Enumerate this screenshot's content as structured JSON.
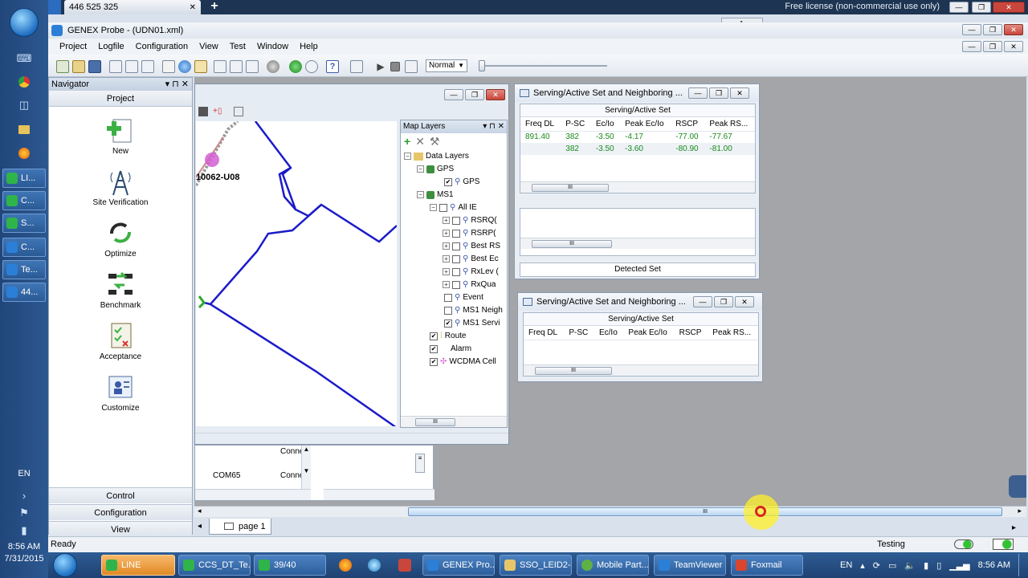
{
  "remote_tab": {
    "label": "446 525 325",
    "close": "✕"
  },
  "free_license": "Free license (non-commercial use only)",
  "window": {
    "title": "GENEX Probe - (UDN01.xml)"
  },
  "menu": [
    "Project",
    "Logfile",
    "Configuration",
    "View",
    "Test",
    "Window",
    "Help"
  ],
  "toolbar": {
    "zoom_mode": "Normal"
  },
  "navigator": {
    "title": "Navigator",
    "project_header": "Project",
    "items": [
      "New",
      "Site Verification",
      "Optimize",
      "Benchmark",
      "Acceptance",
      "Customize"
    ],
    "sections": [
      "Control",
      "Configuration",
      "View"
    ]
  },
  "map": {
    "site_label": "10062-U08",
    "layers_title": "Map Layers",
    "tree": {
      "data_layers": "Data Layers",
      "gps": "GPS",
      "gps_child": "GPS",
      "ms1": "MS1",
      "all_ie": "All IE",
      "children": [
        "RSRQ(",
        "RSRP(",
        "Best RS",
        "Best Ec",
        "RxLev (",
        "RxQua"
      ],
      "event": "Event",
      "ms1_neigh": "MS1 Neigh",
      "ms1_servi": "MS1 Servi",
      "route": "Route",
      "alarm": "Alarm",
      "wcdma_cell": "WCDMA Cell"
    }
  },
  "bottom_list": {
    "row1_status": "Conne",
    "row2_port": "COM65",
    "row2_status": "Conne"
  },
  "serving1": {
    "title": "Serving/Active Set and Neighboring ...",
    "section": "Serving/Active Set",
    "columns": [
      "Freq DL",
      "P-SC",
      "Ec/Io",
      "Peak Ec/Io",
      "RSCP",
      "Peak RS..."
    ],
    "rows": [
      [
        "891.40",
        "382",
        "-3.50",
        "-4.17",
        "-77.00",
        "-77.67"
      ],
      [
        "",
        "382",
        "-3.50",
        "-3.60",
        "-80.90",
        "-81.00"
      ]
    ],
    "detected_set": "Detected Set"
  },
  "serving2": {
    "title": "Serving/Active Set and Neighboring ...",
    "section": "Serving/Active Set",
    "columns": [
      "Freq DL",
      "P-SC",
      "Ec/Io",
      "Peak Ec/Io",
      "RSCP",
      "Peak RS..."
    ]
  },
  "page_tab": "page 1",
  "status": {
    "left": "Ready",
    "right": "Testing"
  },
  "left_taskbar": {
    "tasks": [
      "LI...",
      "C...",
      "S...",
      "C...",
      "Te...",
      "44..."
    ],
    "clock_time": "8:56 AM",
    "clock_date": "7/31/2015",
    "lang": "EN"
  },
  "taskbar": {
    "tasks": [
      "LINE",
      "CCS_DT_Te...",
      "39/40",
      "GENEX Pro...",
      "SSO_LEID2-...",
      "Mobile Part...",
      "TeamViewer",
      "Foxmail"
    ],
    "lang": "EN",
    "clock": "8:56 AM"
  }
}
